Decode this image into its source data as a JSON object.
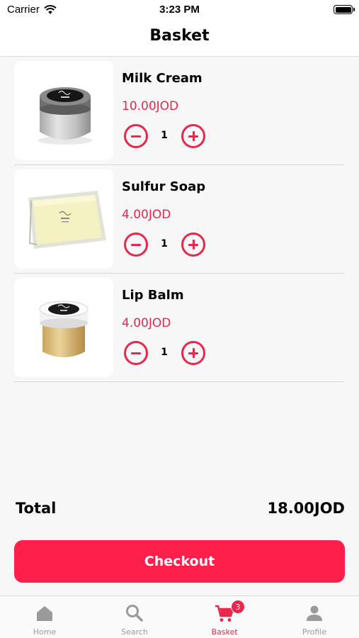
{
  "status_bar": {
    "carrier": "Carrier",
    "time": "3:23 PM"
  },
  "header": {
    "title": "Basket"
  },
  "cart": {
    "items": [
      {
        "name": "Milk Cream",
        "price": "10.00JOD",
        "quantity": "1",
        "image": "cream-jar"
      },
      {
        "name": "Sulfur Soap",
        "price": "4.00JOD",
        "quantity": "1",
        "image": "soap-bar"
      },
      {
        "name": "Lip Balm",
        "price": "4.00JOD",
        "quantity": "1",
        "image": "balm-jar"
      }
    ]
  },
  "summary": {
    "total_label": "Total",
    "total_value": "18.00JOD"
  },
  "checkout": {
    "label": "Checkout"
  },
  "tab_bar": {
    "tabs": [
      {
        "label": "Home",
        "icon": "home-icon",
        "active": false
      },
      {
        "label": "Search",
        "icon": "search-icon",
        "active": false
      },
      {
        "label": "Basket",
        "icon": "cart-icon",
        "active": true,
        "badge": "3"
      },
      {
        "label": "Profile",
        "icon": "profile-icon",
        "active": false
      }
    ]
  },
  "colors": {
    "accent": "#e8274b",
    "button": "#ff1f4b",
    "inactive": "#9a9a9a"
  }
}
